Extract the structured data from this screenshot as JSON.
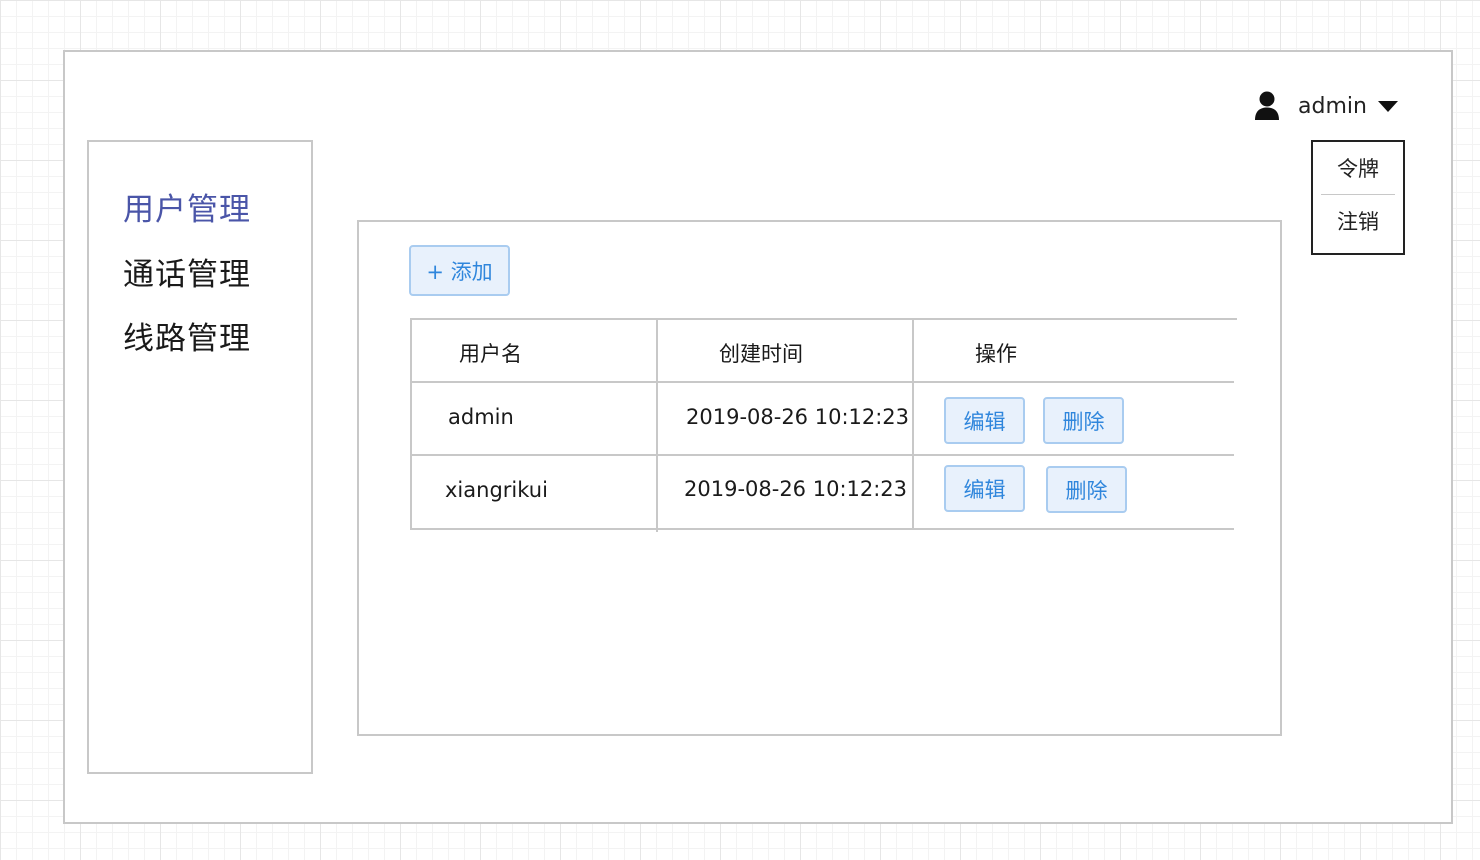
{
  "header": {
    "user_name": "admin",
    "dropdown": [
      "令牌",
      "注销"
    ]
  },
  "sidebar": {
    "items": [
      {
        "label": "用户管理",
        "active": true
      },
      {
        "label": "通话管理",
        "active": false
      },
      {
        "label": "线路管理",
        "active": false
      }
    ]
  },
  "toolbar": {
    "add_label": "+ 添加"
  },
  "table": {
    "columns": [
      "用户名",
      "创建时间",
      "操作"
    ],
    "rows": [
      {
        "username": "admin",
        "created": "2019-08-26 10:12:23",
        "edit": "编辑",
        "delete": "删除"
      },
      {
        "username": "xiangrikui",
        "created": "2019-08-26 10:12:23",
        "edit": "编辑",
        "delete": "删除"
      }
    ]
  },
  "colors": {
    "active_nav": "#4a55a8",
    "button_text": "#2f86dc",
    "button_bg": "#e8f1fc",
    "button_border": "#a9ccf0"
  },
  "icons": {
    "user": "user-icon",
    "caret": "caret-down-icon"
  }
}
